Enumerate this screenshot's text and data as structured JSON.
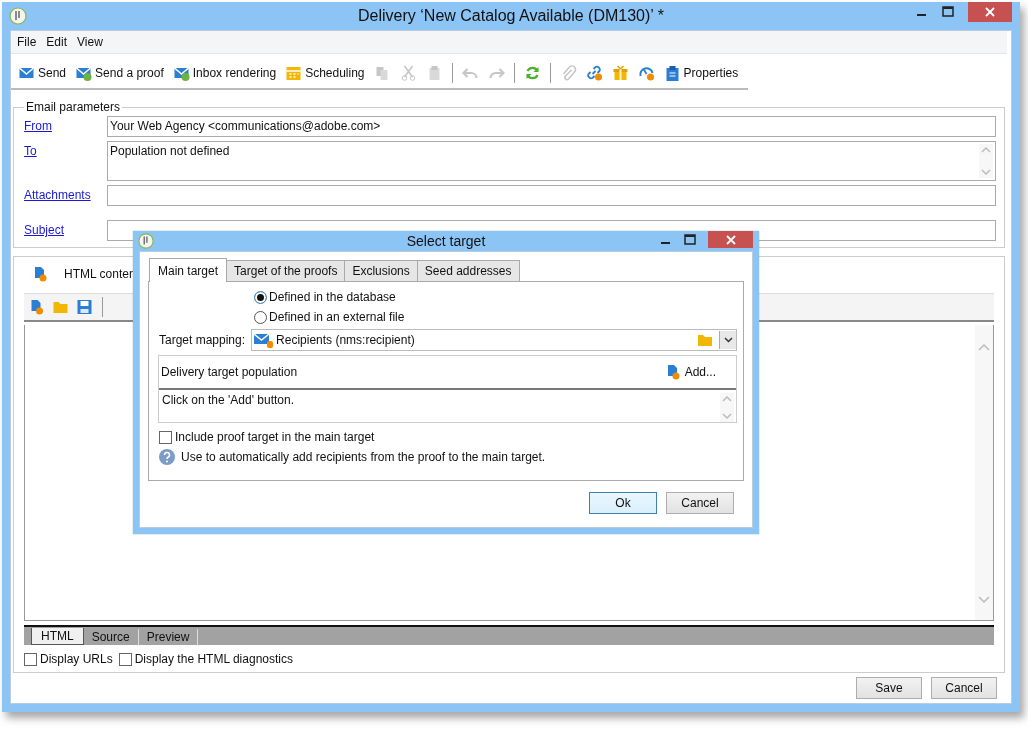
{
  "window": {
    "title": "Delivery ‘New Catalog Available (DM130)’ *"
  },
  "menu": [
    "File",
    "Edit",
    "View"
  ],
  "toolbar": [
    {
      "kind": "labeled",
      "label": "Send",
      "disabled": false
    },
    {
      "kind": "labeled",
      "label": "Send a proof",
      "disabled": false
    },
    {
      "kind": "labeled",
      "label": "Inbox rendering",
      "disabled": false
    },
    {
      "kind": "labeled",
      "label": "Scheduling",
      "disabled": false
    },
    {
      "kind": "icon",
      "disabled": true
    },
    {
      "kind": "icon",
      "disabled": true
    },
    {
      "kind": "icon",
      "disabled": true
    },
    {
      "kind": "separator"
    },
    {
      "kind": "icon",
      "disabled": true
    },
    {
      "kind": "icon",
      "disabled": true
    },
    {
      "kind": "separator"
    },
    {
      "kind": "icon",
      "disabled": false
    },
    {
      "kind": "separator"
    },
    {
      "kind": "icon",
      "disabled": true
    },
    {
      "kind": "icon",
      "disabled": false
    },
    {
      "kind": "icon",
      "disabled": false
    },
    {
      "kind": "icon",
      "disabled": false
    },
    {
      "kind": "labeled",
      "label": "Properties",
      "disabled": false
    }
  ],
  "email_parameters": {
    "title": "Email parameters",
    "fields": [
      {
        "label": "From",
        "value": "Your Web Agency <communications@adobe.com>",
        "kind": "single"
      },
      {
        "label": "To",
        "value": "Population not defined",
        "kind": "multiline"
      },
      {
        "label": "Attachments",
        "kind": "single"
      },
      {
        "label": "Subject",
        "kind": "single"
      }
    ]
  },
  "content": {
    "tab": "HTML conten",
    "bottom_tabs": [
      {
        "label": "HTML",
        "selected": true
      },
      {
        "label": "Source",
        "selected": false
      },
      {
        "label": "Preview",
        "selected": false
      }
    ],
    "options": [
      {
        "label": "Display URLs",
        "checked": false
      },
      {
        "label": "Display the HTML diagnostics",
        "checked": false
      }
    ]
  },
  "buttons": [
    "Save",
    "Cancel"
  ],
  "dialog": {
    "title": "Select target",
    "tabs": [
      {
        "label": "Main target",
        "selected": true
      },
      {
        "label": "Target of the proofs",
        "selected": false
      },
      {
        "label": "Exclusions",
        "selected": false
      },
      {
        "label": "Seed addresses",
        "selected": false
      }
    ],
    "radios": [
      {
        "label": "Defined in the database",
        "selected": true
      },
      {
        "label": "Defined in an external file",
        "selected": false
      }
    ],
    "mapping": {
      "label": "Target mapping:",
      "value": "Recipients (nms:recipient)"
    },
    "population": {
      "title": "Delivery target population",
      "add": "Add...",
      "text": "Click on the 'Add' button."
    },
    "include": {
      "label": "Include proof target in the main target",
      "checked": false
    },
    "info": "Use to automatically add recipients from the proof to the main target.",
    "buttons": [
      {
        "label": "Ok",
        "default": true
      },
      {
        "label": "Cancel",
        "default": false
      }
    ]
  }
}
